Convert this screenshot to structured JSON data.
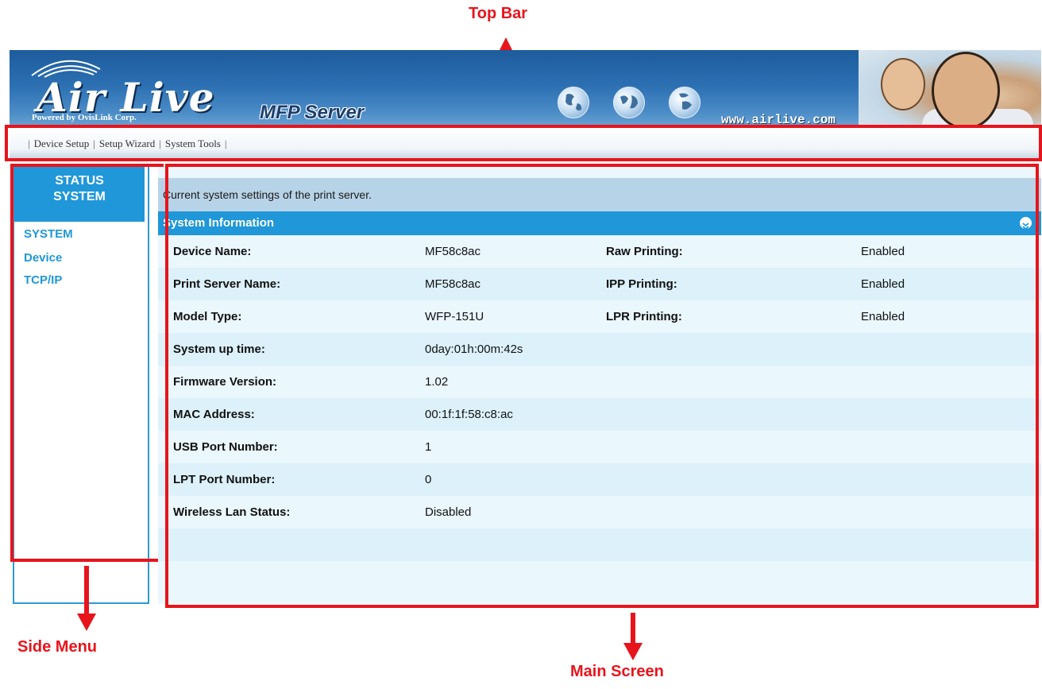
{
  "annotations": {
    "top_bar": "Top Bar",
    "side_menu": "Side Menu",
    "main_screen": "Main Screen"
  },
  "header": {
    "logo": "Air Live",
    "logo_sub": "Powered by OvisLink Corp.",
    "product": "MFP Server",
    "website": "www.airlive.com",
    "icons": [
      "globe-icon",
      "globe-icon",
      "globe-icon"
    ]
  },
  "nav": {
    "items": [
      "Device Setup",
      "Setup Wizard",
      "System Tools"
    ]
  },
  "sidebar": {
    "heading_line1": "STATUS",
    "heading_line2": "SYSTEM",
    "links": [
      "SYSTEM",
      "Device",
      "TCP/IP"
    ]
  },
  "main": {
    "description": "Current system settings of the print server.",
    "section_title": "System Information",
    "rows": [
      {
        "label": "Device Name:",
        "value": "MF58c8ac",
        "label2": "Raw Printing:",
        "value2": "Enabled"
      },
      {
        "label": "Print Server Name:",
        "value": "MF58c8ac",
        "label2": "IPP Printing:",
        "value2": "Enabled"
      },
      {
        "label": "Model Type:",
        "value": "WFP-151U",
        "label2": "LPR Printing:",
        "value2": "Enabled"
      },
      {
        "label": "System up time:",
        "value": "0day:01h:00m:42s",
        "label2": "",
        "value2": ""
      },
      {
        "label": "Firmware Version:",
        "value": "1.02",
        "label2": "",
        "value2": ""
      },
      {
        "label": "MAC Address:",
        "value": "00:1f:1f:58:c8:ac",
        "label2": "",
        "value2": ""
      },
      {
        "label": "USB Port Number:",
        "value": "1",
        "label2": "",
        "value2": ""
      },
      {
        "label": "LPT Port Number:",
        "value": "0",
        "label2": "",
        "value2": ""
      },
      {
        "label": "Wireless Lan Status:",
        "value": "Disabled",
        "label2": "",
        "value2": ""
      }
    ]
  },
  "colors": {
    "annotation_red": "#e8141c",
    "accent_blue": "#1f97d8",
    "header_blue": "#2b6fb2",
    "row_light": "#eaf7fc",
    "row_alt": "#dcf1fa"
  }
}
